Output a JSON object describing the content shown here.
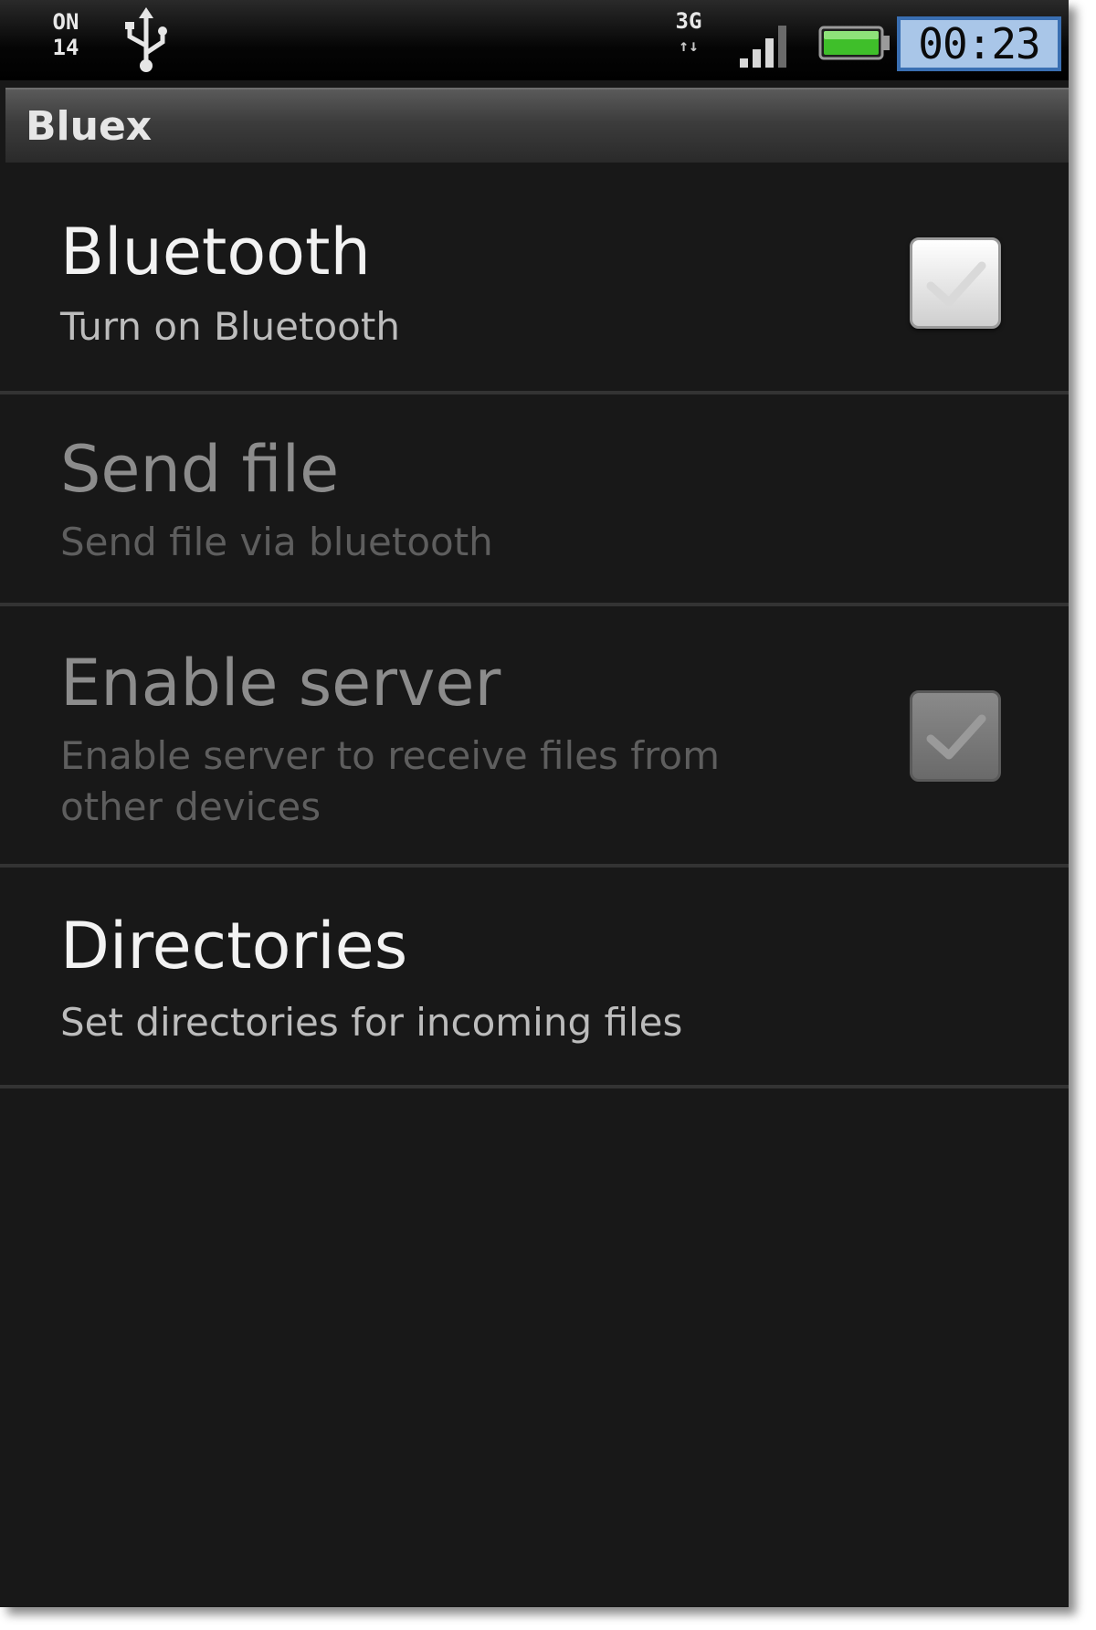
{
  "status_bar": {
    "notification_lines": [
      "ON",
      "14"
    ],
    "network_type": "3G",
    "network_arrows": "↑↓",
    "clock": "00:23",
    "battery_color": "#3fbf2a",
    "clock_bg_color": "#a9c6e8",
    "icons": [
      "notification-icon",
      "usb-icon",
      "network-3g-icon",
      "signal-icon",
      "battery-icon"
    ]
  },
  "app": {
    "title": "Bluex"
  },
  "preferences": [
    {
      "id": "bluetooth",
      "title": "Bluetooth",
      "summary": "Turn on Bluetooth",
      "enabled": true,
      "has_checkbox": true,
      "checked": false
    },
    {
      "id": "send-file",
      "title": "Send file",
      "summary": "Send file via bluetooth",
      "enabled": false,
      "has_checkbox": false
    },
    {
      "id": "enable-server",
      "title": "Enable server",
      "summary": "Enable server to receive files from other devices",
      "enabled": false,
      "has_checkbox": true,
      "checked": false
    },
    {
      "id": "directories",
      "title": "Directories",
      "summary": "Set directories for incoming files",
      "enabled": true,
      "has_checkbox": false
    }
  ],
  "colors": {
    "background": "#181818",
    "divider": "#333333",
    "title_text": "#f2f2f2",
    "disabled_text": "#8c8c8c"
  }
}
